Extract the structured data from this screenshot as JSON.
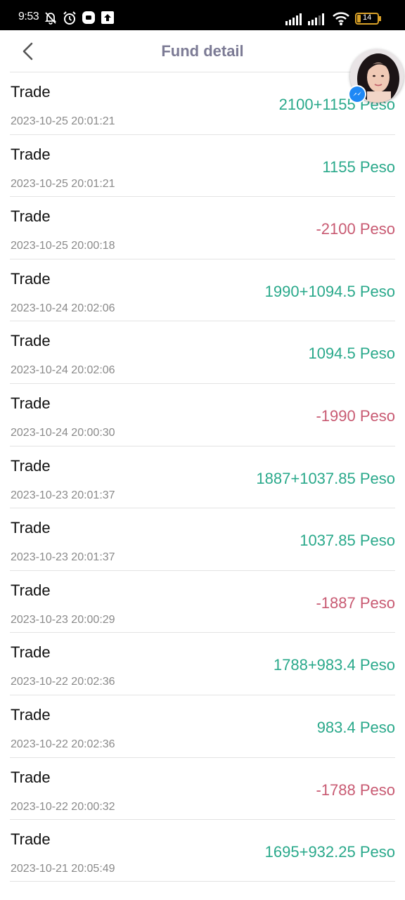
{
  "status_bar": {
    "time": "9:53",
    "battery": "14"
  },
  "header": {
    "title": "Fund detail",
    "back_icon": "chevron-left-icon"
  },
  "colors": {
    "positive": "#2aa98b",
    "negative": "#c85a72",
    "title": "#7c7b95"
  },
  "transactions": [
    {
      "title": "Trade",
      "time": "2023-10-25 20:01:21",
      "amount": "2100+1155 Peso",
      "sign": "pos"
    },
    {
      "title": "Trade",
      "time": "2023-10-25 20:01:21",
      "amount": "1155 Peso",
      "sign": "pos"
    },
    {
      "title": "Trade",
      "time": "2023-10-25 20:00:18",
      "amount": "-2100 Peso",
      "sign": "neg"
    },
    {
      "title": "Trade",
      "time": "2023-10-24 20:02:06",
      "amount": "1990+1094.5 Peso",
      "sign": "pos"
    },
    {
      "title": "Trade",
      "time": "2023-10-24 20:02:06",
      "amount": "1094.5 Peso",
      "sign": "pos"
    },
    {
      "title": "Trade",
      "time": "2023-10-24 20:00:30",
      "amount": "-1990 Peso",
      "sign": "neg"
    },
    {
      "title": "Trade",
      "time": "2023-10-23 20:01:37",
      "amount": "1887+1037.85 Peso",
      "sign": "pos"
    },
    {
      "title": "Trade",
      "time": "2023-10-23 20:01:37",
      "amount": "1037.85 Peso",
      "sign": "pos"
    },
    {
      "title": "Trade",
      "time": "2023-10-23 20:00:29",
      "amount": "-1887 Peso",
      "sign": "neg"
    },
    {
      "title": "Trade",
      "time": "2023-10-22 20:02:36",
      "amount": "1788+983.4 Peso",
      "sign": "pos"
    },
    {
      "title": "Trade",
      "time": "2023-10-22 20:02:36",
      "amount": "983.4 Peso",
      "sign": "pos"
    },
    {
      "title": "Trade",
      "time": "2023-10-22 20:00:32",
      "amount": "-1788 Peso",
      "sign": "neg"
    },
    {
      "title": "Trade",
      "time": "2023-10-21 20:05:49",
      "amount": "1695+932.25 Peso",
      "sign": "pos"
    }
  ],
  "overlay": {
    "chat_head_icon": "messenger-chat-head-icon"
  }
}
